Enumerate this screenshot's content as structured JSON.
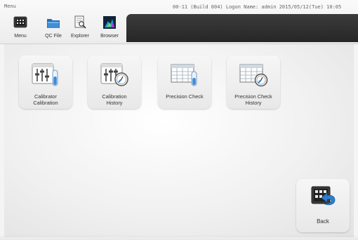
{
  "header": {
    "screen_title": "Menu",
    "status_line": "00-11 (Build 004)  Logon Name: admin   2015/05/12(Tue) 10:05"
  },
  "toolbar": {
    "items": [
      {
        "label": "Menu",
        "icon": "menu-grid-icon"
      },
      {
        "label": "QC File",
        "icon": "folder-icon"
      },
      {
        "label": "Explorer",
        "icon": "explorer-icon"
      },
      {
        "label": "Browser",
        "icon": "browser-icon"
      }
    ]
  },
  "tiles": [
    {
      "label_line1": "Calibrator",
      "label_line2": "Calibration",
      "icon": "calibrator-sliders-icon"
    },
    {
      "label_line1": "Calibration",
      "label_line2": "History",
      "icon": "calibration-history-icon"
    },
    {
      "label_line1": "Precision Check",
      "label_line2": "",
      "icon": "precision-check-icon"
    },
    {
      "label_line1": "Precision Check",
      "label_line2": "History",
      "icon": "precision-history-icon"
    }
  ],
  "back": {
    "label": "Back",
    "icon": "back-arrow-icon"
  },
  "colors": {
    "accent_blue": "#2f7fd0",
    "dark_bar": "#2e2e2e"
  }
}
